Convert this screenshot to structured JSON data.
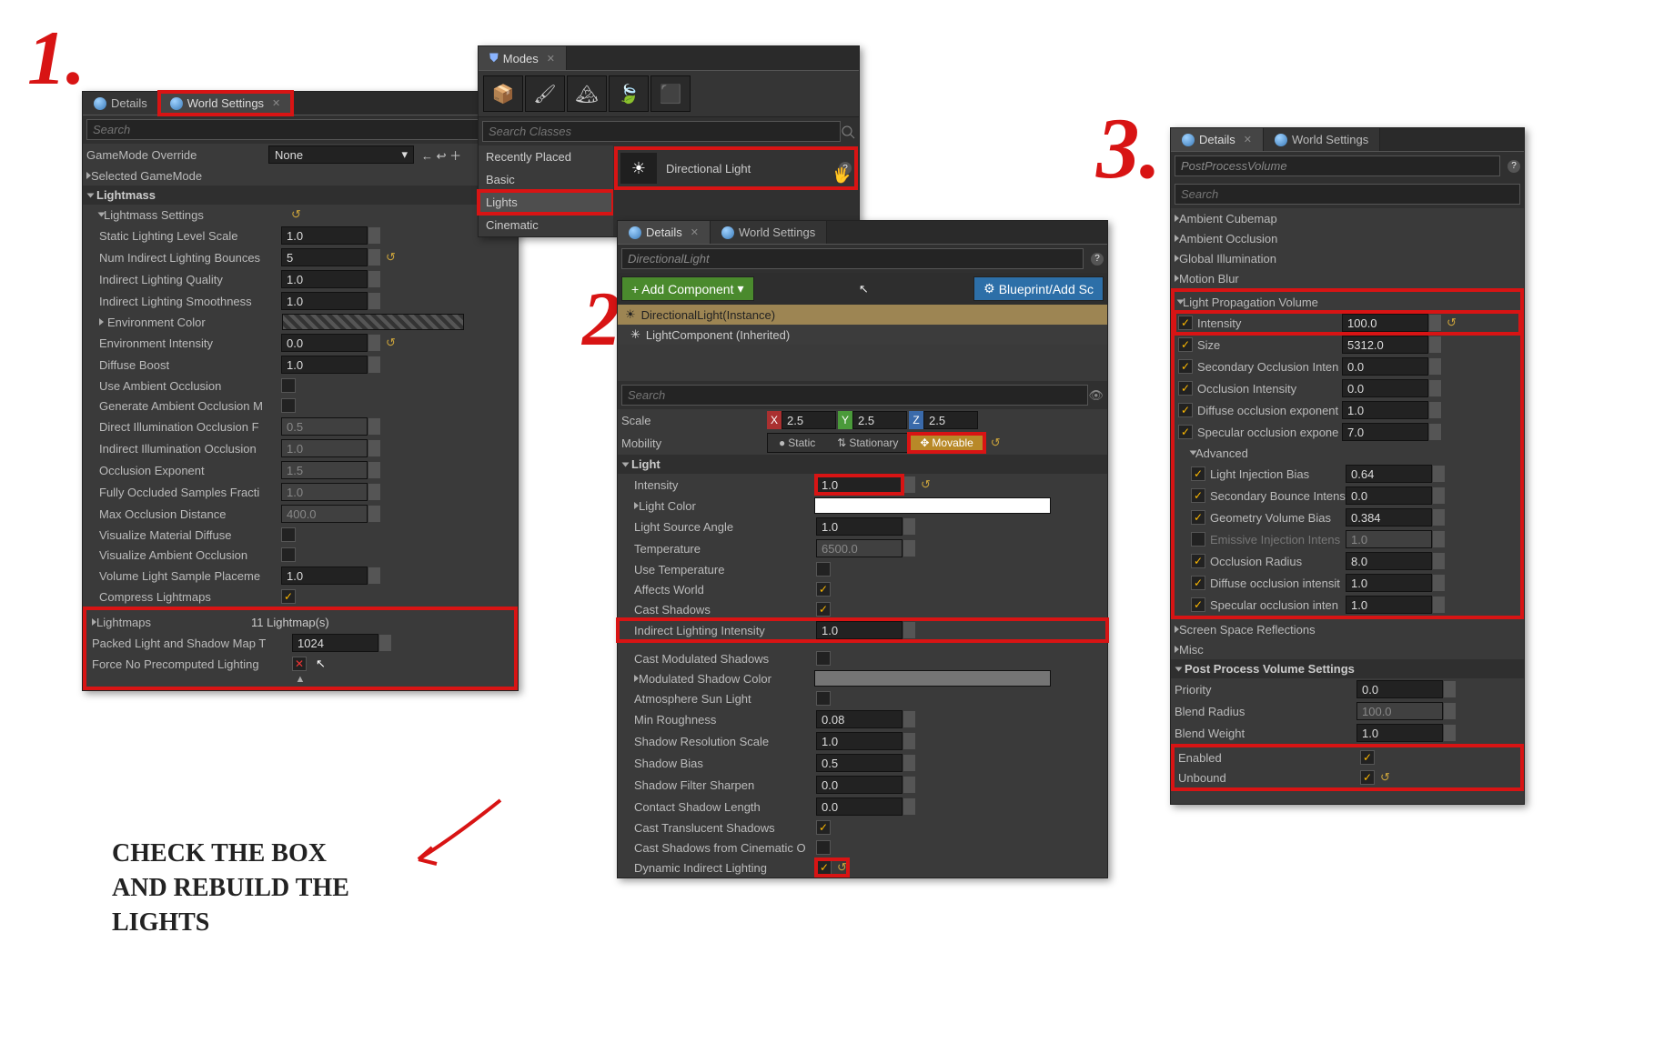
{
  "tabs": {
    "details": "Details",
    "worldSettings": "World Settings"
  },
  "search_placeholder": "Search",
  "panel1": {
    "gamemode_override": "GameMode Override",
    "gamemode_value": "None",
    "selected_gamemode": "Selected GameMode",
    "lightmass": "Lightmass",
    "lightmass_settings": "Lightmass Settings",
    "static_lighting_level_scale": "Static Lighting Level Scale",
    "static_lighting_level_scale_v": "1.0",
    "num_indirect_bounces": "Num Indirect Lighting Bounces",
    "num_indirect_bounces_v": "5",
    "indirect_quality": "Indirect Lighting Quality",
    "indirect_quality_v": "1.0",
    "indirect_smoothness": "Indirect Lighting Smoothness",
    "indirect_smoothness_v": "1.0",
    "environment_color": "Environment Color",
    "environment_intensity": "Environment Intensity",
    "environment_intensity_v": "0.0",
    "diffuse_boost": "Diffuse Boost",
    "diffuse_boost_v": "1.0",
    "use_ao": "Use Ambient Occlusion",
    "gen_ao": "Generate Ambient Occlusion M",
    "direct_illum_occl": "Direct Illumination Occlusion F",
    "direct_illum_occl_v": "0.5",
    "indirect_illum_occl": "Indirect Illumination Occlusion",
    "indirect_illum_occl_v": "1.0",
    "occl_exp": "Occlusion Exponent",
    "occl_exp_v": "1.5",
    "fully_occl": "Fully Occluded Samples Fracti",
    "fully_occl_v": "1.0",
    "max_occl_dist": "Max Occlusion Distance",
    "max_occl_dist_v": "400.0",
    "viz_mat_diff": "Visualize Material Diffuse",
    "viz_ao": "Visualize Ambient Occlusion",
    "vol_light_sample": "Volume Light Sample Placeme",
    "vol_light_sample_v": "1.0",
    "compress_lm": "Compress Lightmaps",
    "lightmaps": "Lightmaps",
    "lightmaps_count": "11 Lightmap(s)",
    "packed_lm": "Packed Light and Shadow Map T",
    "packed_lm_v": "1024",
    "force_no_precomp": "Force No Precomputed Lighting"
  },
  "modes": {
    "title": "Modes",
    "search_classes": "Search Classes",
    "recently_placed": "Recently Placed",
    "basic": "Basic",
    "lights": "Lights",
    "cinematic": "Cinematic",
    "directional_light": "Directional Light"
  },
  "panel2": {
    "name": "DirectionalLight",
    "add_component": "+ Add Component",
    "blueprint_add": "Blueprint/Add Sc",
    "instance": "DirectionalLight(Instance)",
    "light_component": "LightComponent (Inherited)",
    "scale": "Scale",
    "scale_x": "2.5",
    "scale_y": "2.5",
    "scale_z": "2.5",
    "mobility": "Mobility",
    "mob_static": "Static",
    "mob_stationary": "Stationary",
    "mob_movable": "Movable",
    "light_section": "Light",
    "intensity": "Intensity",
    "intensity_v": "1.0",
    "light_color": "Light Color",
    "light_source_angle": "Light Source Angle",
    "light_source_angle_v": "1.0",
    "temperature": "Temperature",
    "temperature_v": "6500.0",
    "use_temp": "Use Temperature",
    "affects_world": "Affects World",
    "cast_shadows": "Cast Shadows",
    "indirect_li": "Indirect Lighting Intensity",
    "indirect_li_v": "1.0",
    "cast_mod": "Cast Modulated Shadows",
    "mod_shadow_color": "Modulated Shadow Color",
    "atmos_sun": "Atmosphere Sun Light",
    "min_rough": "Min Roughness",
    "min_rough_v": "0.08",
    "shadow_res": "Shadow Resolution Scale",
    "shadow_res_v": "1.0",
    "shadow_bias": "Shadow Bias",
    "shadow_bias_v": "0.5",
    "shadow_filter": "Shadow Filter Sharpen",
    "shadow_filter_v": "0.0",
    "contact_shadow": "Contact Shadow Length",
    "contact_shadow_v": "0.0",
    "cast_trans": "Cast Translucent Shadows",
    "cast_cinematic": "Cast Shadows from Cinematic O",
    "dyn_indirect": "Dynamic Indirect Lighting"
  },
  "panel3": {
    "name": "PostProcessVolume",
    "ambient_cubemap": "Ambient Cubemap",
    "ambient_occlusion": "Ambient Occlusion",
    "global_illum": "Global Illumination",
    "motion_blur": "Motion Blur",
    "lpv": "Light Propagation Volume",
    "intensity": "Intensity",
    "intensity_v": "100.0",
    "size": "Size",
    "size_v": "5312.0",
    "sec_occl_int": "Secondary Occlusion Inten",
    "sec_occl_int_v": "0.0",
    "occl_int": "Occlusion Intensity",
    "occl_int_v": "0.0",
    "diff_occl_exp": "Diffuse occlusion exponent",
    "diff_occl_exp_v": "1.0",
    "spec_occl_exp": "Specular occlusion expone",
    "spec_occl_exp_v": "7.0",
    "advanced": "Advanced",
    "light_inj_bias": "Light Injection Bias",
    "light_inj_bias_v": "0.64",
    "sec_bounce_int": "Secondary Bounce Intens",
    "sec_bounce_int_v": "0.0",
    "geom_vol_bias": "Geometry Volume Bias",
    "geom_vol_bias_v": "0.384",
    "emissive_inj": "Emissive Injection Intens",
    "emissive_inj_v": "1.0",
    "occl_radius": "Occlusion Radius",
    "occl_radius_v": "8.0",
    "diff_occl_int": "Diffuse occlusion intensit",
    "diff_occl_int_v": "1.0",
    "spec_occl_int": "Specular occlusion inten",
    "spec_occl_int_v": "1.0",
    "ssr": "Screen Space Reflections",
    "misc": "Misc",
    "ppv_settings": "Post Process Volume Settings",
    "priority": "Priority",
    "priority_v": "0.0",
    "blend_radius": "Blend Radius",
    "blend_radius_v": "100.0",
    "blend_weight": "Blend Weight",
    "blend_weight_v": "1.0",
    "enabled": "Enabled",
    "unbound": "Unbound"
  },
  "notes": {
    "n1": "1.",
    "n2": "2.",
    "n3": "3.",
    "check_box": "Check the box\nand rebuild the\nlights"
  }
}
